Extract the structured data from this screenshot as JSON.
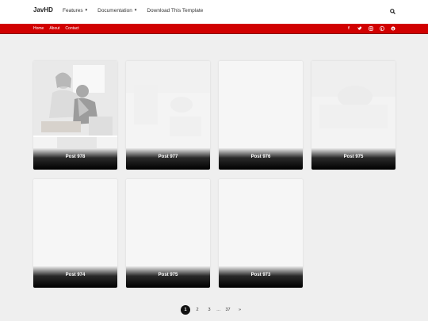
{
  "header": {
    "brand": "JavHD",
    "nav": [
      {
        "label": "Features",
        "dropdown": true
      },
      {
        "label": "Documentation",
        "dropdown": true
      },
      {
        "label": "Download This Template",
        "dropdown": false
      }
    ],
    "search_icon": "search-icon"
  },
  "subnav": {
    "links": [
      "Home",
      "About",
      "Contact"
    ],
    "social_icons": [
      "facebook-icon",
      "twitter-icon",
      "instagram-icon",
      "pinterest-icon",
      "skype-icon"
    ],
    "color": "#d10000"
  },
  "posts": [
    {
      "title": "Post 978"
    },
    {
      "title": "Post 977"
    },
    {
      "title": "Post 976"
    },
    {
      "title": "Post 975"
    },
    {
      "title": "Post 974"
    },
    {
      "title": "Post 975"
    },
    {
      "title": "Post 973"
    }
  ],
  "pagination": {
    "pages": [
      "1",
      "2",
      "3"
    ],
    "ellipsis": "…",
    "last": "37",
    "next": "»",
    "current": "1"
  }
}
